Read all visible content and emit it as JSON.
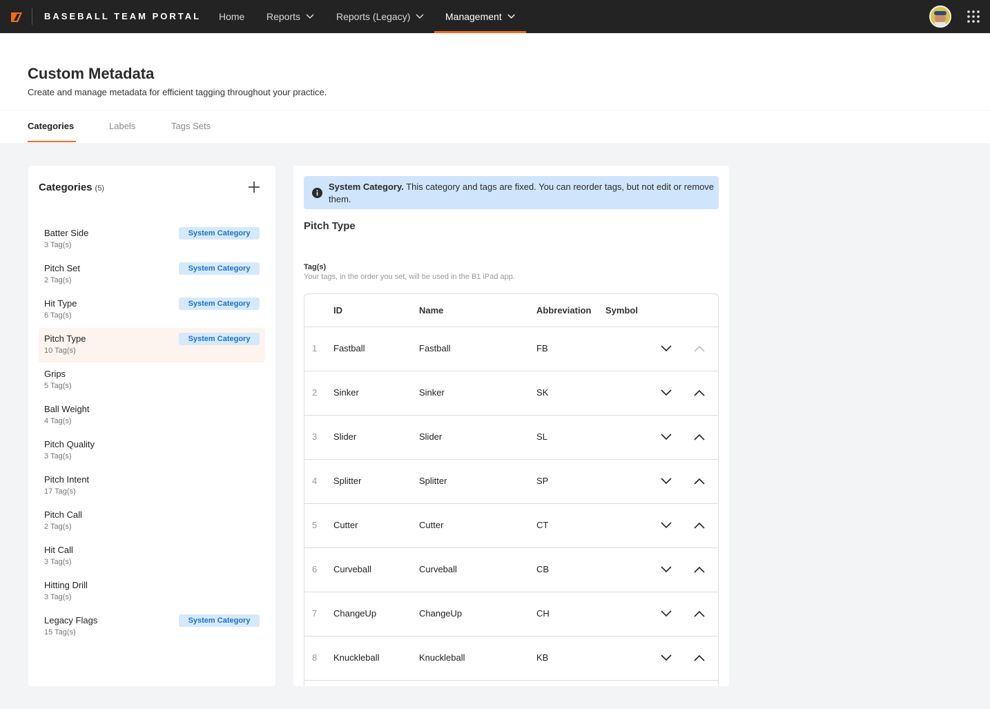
{
  "nav": {
    "brand": "BASEBALL TEAM PORTAL",
    "items": [
      {
        "label": "Home",
        "has_menu": false
      },
      {
        "label": "Reports",
        "has_menu": true
      },
      {
        "label": "Reports (Legacy)",
        "has_menu": true
      },
      {
        "label": "Management",
        "has_menu": true,
        "active": true
      }
    ],
    "accent_color": "#f26b1d"
  },
  "header": {
    "title": "Custom Metadata",
    "subtitle": "Create and manage metadata for efficient tagging throughout your practice.",
    "tabs": [
      {
        "label": "Categories",
        "active": true
      },
      {
        "label": "Labels"
      },
      {
        "label": "Tags Sets"
      }
    ]
  },
  "categories": {
    "title": "Categories",
    "count": "(5)",
    "add_icon": "plus-icon",
    "badge_label": "System Category",
    "items": [
      {
        "name": "Batter Side",
        "tags": "3 Tag(s)",
        "system": true
      },
      {
        "name": "Pitch Set",
        "tags": "2 Tag(s)",
        "system": true
      },
      {
        "name": "Hit Type",
        "tags": "6 Tag(s)",
        "system": true
      },
      {
        "name": "Pitch Type",
        "tags": "10 Tag(s)",
        "system": true,
        "selected": true
      },
      {
        "name": "Grips",
        "tags": "5 Tag(s)",
        "system": false
      },
      {
        "name": "Ball Weight",
        "tags": "4 Tag(s)",
        "system": false
      },
      {
        "name": "Pitch Quality",
        "tags": "3 Tag(s)",
        "system": false
      },
      {
        "name": "Pitch Intent",
        "tags": "17 Tag(s)",
        "system": false
      },
      {
        "name": "Pitch Call",
        "tags": "2 Tag(s)",
        "system": false
      },
      {
        "name": "Hit Call",
        "tags": "3 Tag(s)",
        "system": false
      },
      {
        "name": "Hitting Drill",
        "tags": "3 Tag(s)",
        "system": false
      },
      {
        "name": "Legacy Flags",
        "tags": "15 Tag(s)",
        "system": true
      }
    ]
  },
  "detail": {
    "info_bold": "System Category.",
    "info_text": " This category and tags are fixed. You can reorder tags, but not edit or remove them.",
    "title": "Pitch Type",
    "tags_label": "Tag(s)",
    "tags_help": "Your tags, in the order you set, will be used in the B1 iPad app.",
    "columns": [
      "ID",
      "Name",
      "Abbreviation",
      "Symbol"
    ],
    "rows": [
      {
        "index": "1",
        "id": "Fastball",
        "name": "Fastball",
        "abbr": "FB",
        "up_disabled": true
      },
      {
        "index": "2",
        "id": "Sinker",
        "name": "Sinker",
        "abbr": "SK"
      },
      {
        "index": "3",
        "id": "Slider",
        "name": "Slider",
        "abbr": "SL"
      },
      {
        "index": "4",
        "id": "Splitter",
        "name": "Splitter",
        "abbr": "SP"
      },
      {
        "index": "5",
        "id": "Cutter",
        "name": "Cutter",
        "abbr": "CT"
      },
      {
        "index": "6",
        "id": "Curveball",
        "name": "Curveball",
        "abbr": "CB"
      },
      {
        "index": "7",
        "id": "ChangeUp",
        "name": "ChangeUp",
        "abbr": "CH"
      },
      {
        "index": "8",
        "id": "Knuckleball",
        "name": "Knuckleball",
        "abbr": "KB"
      }
    ]
  }
}
